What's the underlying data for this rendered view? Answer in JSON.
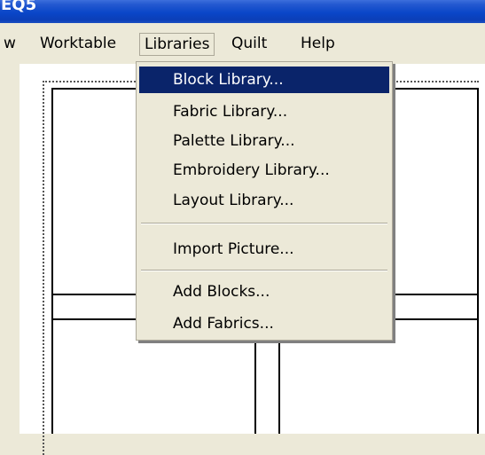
{
  "window": {
    "title": "EQ5"
  },
  "menubar": {
    "items": [
      {
        "label": "w"
      },
      {
        "label": "Worktable"
      },
      {
        "label": "Libraries"
      },
      {
        "label": "Quilt"
      },
      {
        "label": "Help"
      }
    ]
  },
  "libraries_menu": {
    "items": [
      {
        "label": "Block Library..."
      },
      {
        "label": "Fabric Library..."
      },
      {
        "label": "Palette Library..."
      },
      {
        "label": "Embroidery Library..."
      },
      {
        "label": "Layout Library..."
      },
      {
        "label": "Import Picture..."
      },
      {
        "label": "Add Blocks..."
      },
      {
        "label": "Add Fabrics..."
      }
    ],
    "selected_index": 0
  },
  "colors": {
    "titlebar": "#0a46c8",
    "menu_background": "#ece9d8",
    "selection": "#0a246a",
    "workspace": "#ffffff"
  }
}
